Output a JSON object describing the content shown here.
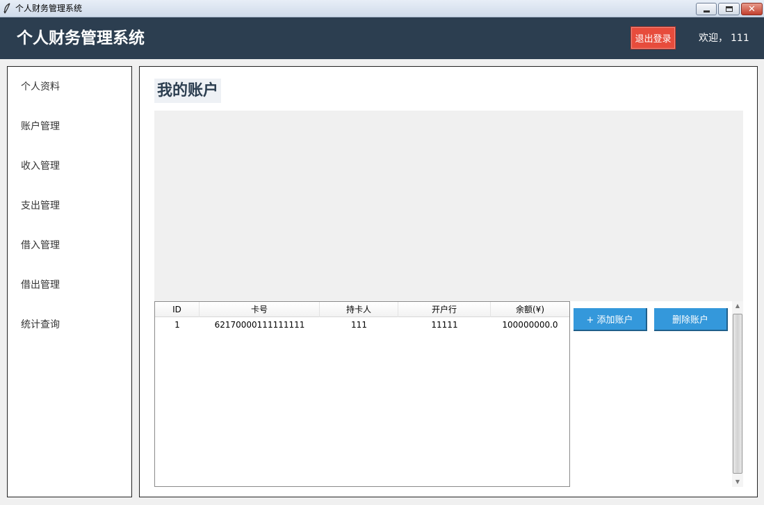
{
  "window": {
    "title": "个人财务管理系统",
    "icon": "feather-icon",
    "controls": {
      "minimize": "minimize-icon",
      "maximize": "maximize-icon",
      "close": "✕"
    }
  },
  "header": {
    "app_title": "个人财务管理系统",
    "logout_label": "退出登录",
    "welcome_label": "欢迎，",
    "username": "111",
    "colors": {
      "header_bg": "#2c3e50",
      "logout_bg": "#e74c3c"
    }
  },
  "sidebar": {
    "items": [
      {
        "label": "个人资料"
      },
      {
        "label": "账户管理"
      },
      {
        "label": "收入管理"
      },
      {
        "label": "支出管理"
      },
      {
        "label": "借入管理"
      },
      {
        "label": "借出管理"
      },
      {
        "label": "统计查询"
      }
    ]
  },
  "main": {
    "page_title": "我的账户",
    "table": {
      "columns": [
        "ID",
        "卡号",
        "持卡人",
        "开户行",
        "余额(¥)"
      ],
      "rows": [
        [
          "1",
          "62170000111111111",
          "111",
          "11111",
          "100000000.0"
        ]
      ]
    },
    "actions": {
      "add_label": "+ 添加账户",
      "delete_label": "删除账户",
      "button_color": "#3498db"
    },
    "scrollbar": {
      "up": "▲",
      "down": "▼"
    }
  }
}
